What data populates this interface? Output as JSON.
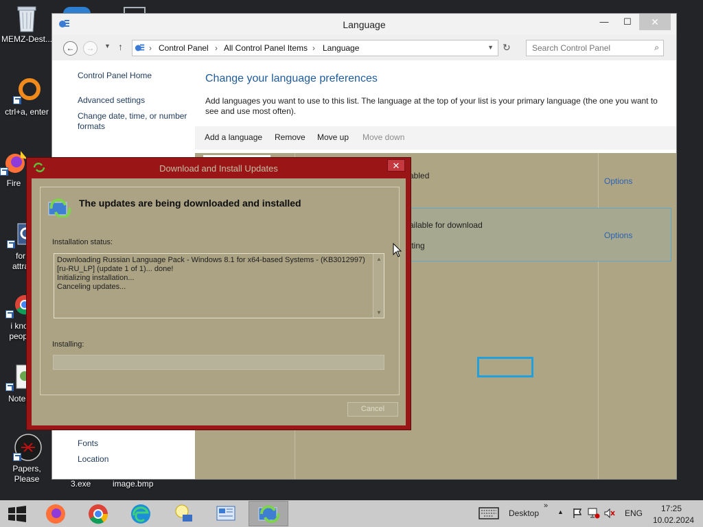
{
  "desktop": {
    "icons": [
      {
        "label": "MEMZ-Dest..."
      },
      {
        "label": "ctrl+a, enter"
      },
      {
        "label": "Fire"
      },
      {
        "label": "for"
      },
      {
        "label": "attra"
      },
      {
        "label": "i kno"
      },
      {
        "label": "peopl"
      },
      {
        "label": "Notep"
      },
      {
        "label": "Papers, Please"
      }
    ],
    "bottom_labels": [
      "3.exe",
      "image.bmp"
    ]
  },
  "language_window": {
    "title": "Language",
    "breadcrumb": [
      "Control Panel",
      "All Control Panel Items",
      "Language"
    ],
    "search_placeholder": "Search Control Panel",
    "left_nav": [
      "Control Panel Home",
      "Advanced settings",
      "Change date, time, or number formats",
      "Fonts",
      "Location"
    ],
    "heading": "Change your language preferences",
    "description": "Add languages you want to use to this list. The language at the top of your list is your primary language (the one you want to see and use most often).",
    "toolbar": [
      "Add a language",
      "Remove",
      "Move up",
      "Move down"
    ],
    "row1_status": "abled",
    "row1_options": "Options",
    "row2_status": "ailable for download",
    "row2_status_2": "tting",
    "row2_options": "Options"
  },
  "update_dialog": {
    "title": "Download and Install Updates",
    "heading": "The updates are being downloaded and installed",
    "status_label": "Installation status:",
    "status_lines": [
      "Downloading Russian Language Pack - Windows 8.1 for x64-based Systems - (KB3012997)",
      "[ru-RU_LP] (update 1 of 1)... done!",
      "Initializing installation...",
      "Canceling updates..."
    ],
    "installing_label": "Installing:",
    "progress_fraction": 0,
    "cancel_label": "Cancel"
  },
  "taskbar": {
    "desktop_label": "Desktop",
    "lang": "ENG",
    "time": "17:25",
    "date": "10.02.2024"
  }
}
